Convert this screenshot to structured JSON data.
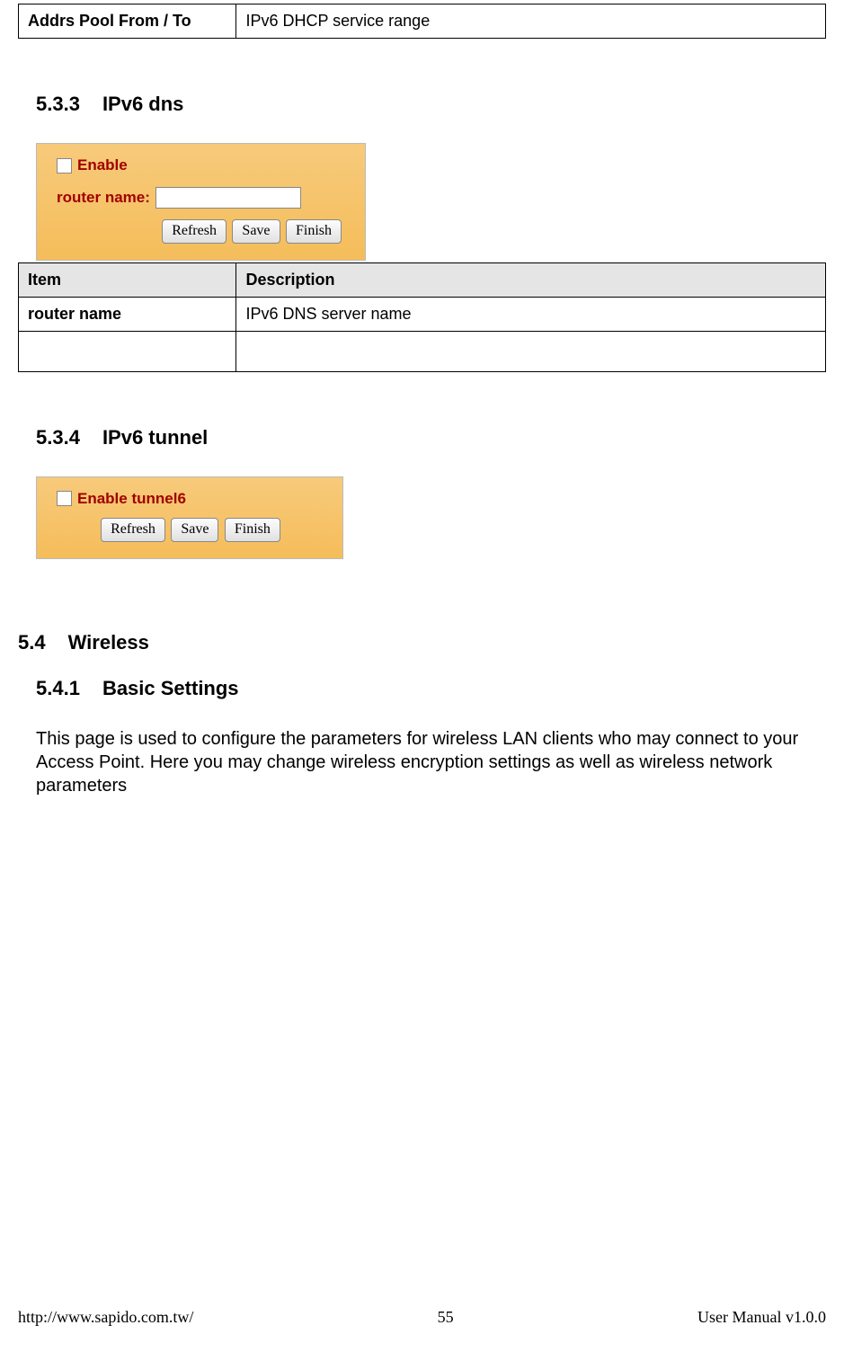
{
  "table_top": {
    "key": "Addrs Pool From / To",
    "value": "IPv6 DHCP service range"
  },
  "section_533": {
    "num": "5.3.3",
    "title": "IPv6 dns",
    "ui": {
      "enable_label": "Enable",
      "router_name_label": "router name:",
      "btn_refresh": "Refresh",
      "btn_save": "Save",
      "btn_finish": "Finish"
    },
    "table": {
      "header_item": "Item",
      "header_desc": "Description",
      "row1_item": "router name",
      "row1_desc": "IPv6 DNS server name"
    }
  },
  "section_534": {
    "num": "5.3.4",
    "title": "IPv6 tunnel",
    "ui": {
      "enable_label": "Enable tunnel6",
      "btn_refresh": "Refresh",
      "btn_save": "Save",
      "btn_finish": "Finish"
    }
  },
  "section_54": {
    "num": "5.4",
    "title": "Wireless"
  },
  "section_541": {
    "num": "5.4.1",
    "title": "Basic Settings",
    "paragraph": "This page is used to configure the parameters for wireless LAN clients who may connect to your Access Point. Here you may change wireless encryption settings as well as wireless network parameters"
  },
  "footer": {
    "url": "http://www.sapido.com.tw/",
    "page": "55",
    "version": "User Manual v1.0.0"
  }
}
